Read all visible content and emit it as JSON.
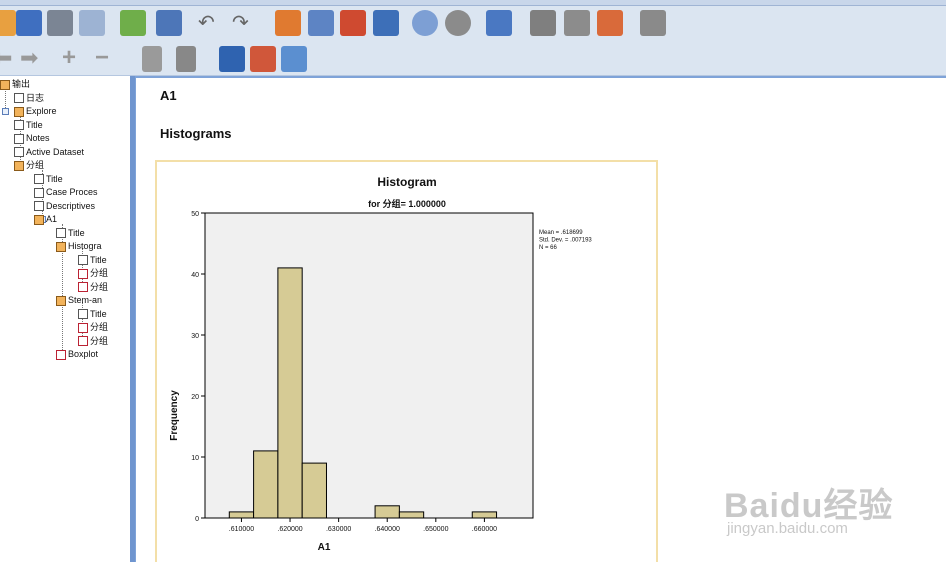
{
  "tree": {
    "items": [
      {
        "label": "输出",
        "depth": 0
      },
      {
        "label": "日志",
        "depth": 1
      },
      {
        "label": "Explore",
        "depth": 1
      },
      {
        "label": "Title",
        "depth": 2
      },
      {
        "label": "Notes",
        "depth": 2
      },
      {
        "label": "Active Dataset",
        "depth": 2
      },
      {
        "label": "分组",
        "depth": 2
      },
      {
        "label": "Title",
        "depth": 3
      },
      {
        "label": "Case Proces",
        "depth": 3
      },
      {
        "label": "Descriptives",
        "depth": 3
      },
      {
        "label": "A1",
        "depth": 3
      },
      {
        "label": "Title",
        "depth": 4
      },
      {
        "label": "Histogra",
        "depth": 4
      },
      {
        "label": "Title",
        "depth": 5
      },
      {
        "label": "分组",
        "depth": 5
      },
      {
        "label": "分组",
        "depth": 5
      },
      {
        "label": "Stem-an",
        "depth": 4
      },
      {
        "label": "Title",
        "depth": 5
      },
      {
        "label": "分组",
        "depth": 5
      },
      {
        "label": "分组",
        "depth": 5
      },
      {
        "label": "Boxplot",
        "depth": 4
      }
    ]
  },
  "viewer": {
    "heading": "A1",
    "section": "Histograms"
  },
  "chart_data": {
    "type": "bar",
    "title": "Histogram",
    "subtitle": "for 分组= 1.000000",
    "xlabel": "A1",
    "ylabel": "Frequency",
    "x_ticks": [
      ".610000",
      ".620000",
      ".630000",
      ".640000",
      ".650000",
      ".660000"
    ],
    "y_ticks": [
      "0",
      "10",
      "20",
      "30",
      "40",
      "50"
    ],
    "ylim": [
      0,
      50
    ],
    "bin_edges": [
      0.6075,
      0.6125,
      0.6175,
      0.6225,
      0.6275,
      0.6325,
      0.6375,
      0.6425,
      0.6475,
      0.6525,
      0.6575,
      0.6625
    ],
    "values": [
      1,
      11,
      41,
      9,
      0,
      0,
      2,
      1,
      0,
      0,
      1
    ],
    "stats": [
      "Mean = .618699",
      "Std. Dev. = .007193",
      "N = 66"
    ],
    "bar_color": "#d6cb95",
    "plot_bg": "#f0f0f0"
  },
  "watermark": {
    "brand": "Baidu经验",
    "url": "jingyan.baidu.com"
  },
  "colors": {
    "app_bg": "#dbe5f1",
    "accent": "#6f95cf"
  }
}
